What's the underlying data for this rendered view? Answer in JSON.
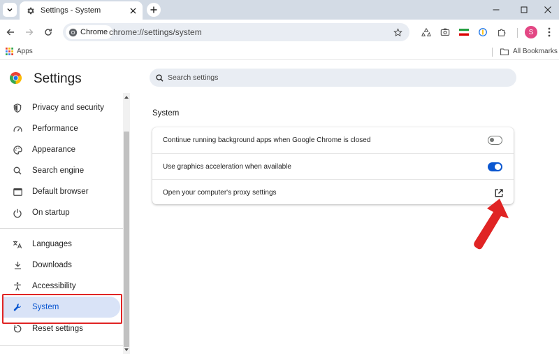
{
  "browser": {
    "tab_title": "Settings - System",
    "omnibox_chip": "Chrome",
    "url": "chrome://settings/system",
    "profile_initial": "S"
  },
  "bookmarks": {
    "apps_label": "Apps",
    "all_bookmarks_label": "All Bookmarks"
  },
  "settings": {
    "title": "Settings",
    "search_placeholder": "Search settings"
  },
  "sidebar": {
    "items": [
      {
        "label": "Privacy and security",
        "icon": "shield-icon"
      },
      {
        "label": "Performance",
        "icon": "speedometer-icon"
      },
      {
        "label": "Appearance",
        "icon": "palette-icon"
      },
      {
        "label": "Search engine",
        "icon": "search-icon"
      },
      {
        "label": "Default browser",
        "icon": "browser-window-icon"
      },
      {
        "label": "On startup",
        "icon": "power-icon"
      },
      {
        "label": "Languages",
        "icon": "translate-icon"
      },
      {
        "label": "Downloads",
        "icon": "download-icon"
      },
      {
        "label": "Accessibility",
        "icon": "accessibility-icon"
      },
      {
        "label": "System",
        "icon": "wrench-icon",
        "selected": true
      },
      {
        "label": "Reset settings",
        "icon": "reset-icon"
      }
    ]
  },
  "main": {
    "section_title": "System",
    "rows": [
      {
        "label": "Continue running background apps when Google Chrome is closed",
        "control": "toggle",
        "on": false
      },
      {
        "label": "Use graphics acceleration when available",
        "control": "toggle",
        "on": true
      },
      {
        "label": "Open your computer's proxy settings",
        "control": "external-link"
      }
    ]
  },
  "colors": {
    "accent": "#0b57d0",
    "selected_nav_bg": "#d9e3f7",
    "annotation_red": "#e02424",
    "tabstrip_bg": "#d3dbe5"
  }
}
